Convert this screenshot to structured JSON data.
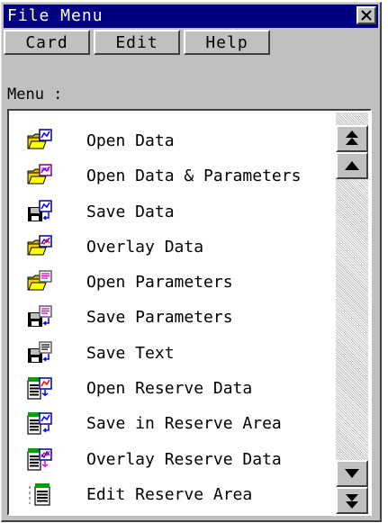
{
  "window": {
    "title": "File Menu"
  },
  "menubar": {
    "items": [
      "Card",
      "Edit",
      "Help"
    ]
  },
  "menu": {
    "label": "Menu :",
    "items": [
      {
        "label": "Open Data",
        "icon": "open-data-icon"
      },
      {
        "label": "Open Data & Parameters",
        "icon": "open-data-parameters-icon"
      },
      {
        "label": "Save Data",
        "icon": "save-data-icon"
      },
      {
        "label": "Overlay Data",
        "icon": "overlay-data-icon"
      },
      {
        "label": "Open Parameters",
        "icon": "open-parameters-icon"
      },
      {
        "label": "Save Parameters",
        "icon": "save-parameters-icon"
      },
      {
        "label": "Save Text",
        "icon": "save-text-icon"
      },
      {
        "label": "Open Reserve Data",
        "icon": "open-reserve-data-icon"
      },
      {
        "label": "Save in Reserve Area",
        "icon": "save-reserve-area-icon"
      },
      {
        "label": "Overlay Reserve Data",
        "icon": "overlay-reserve-data-icon"
      },
      {
        "label": "Edit Reserve Area",
        "icon": "edit-reserve-area-icon"
      }
    ]
  },
  "colors": {
    "titlebar": "#000080",
    "face": "#c0c0c0",
    "shadow": "#404040",
    "highlight": "#ffffff"
  }
}
